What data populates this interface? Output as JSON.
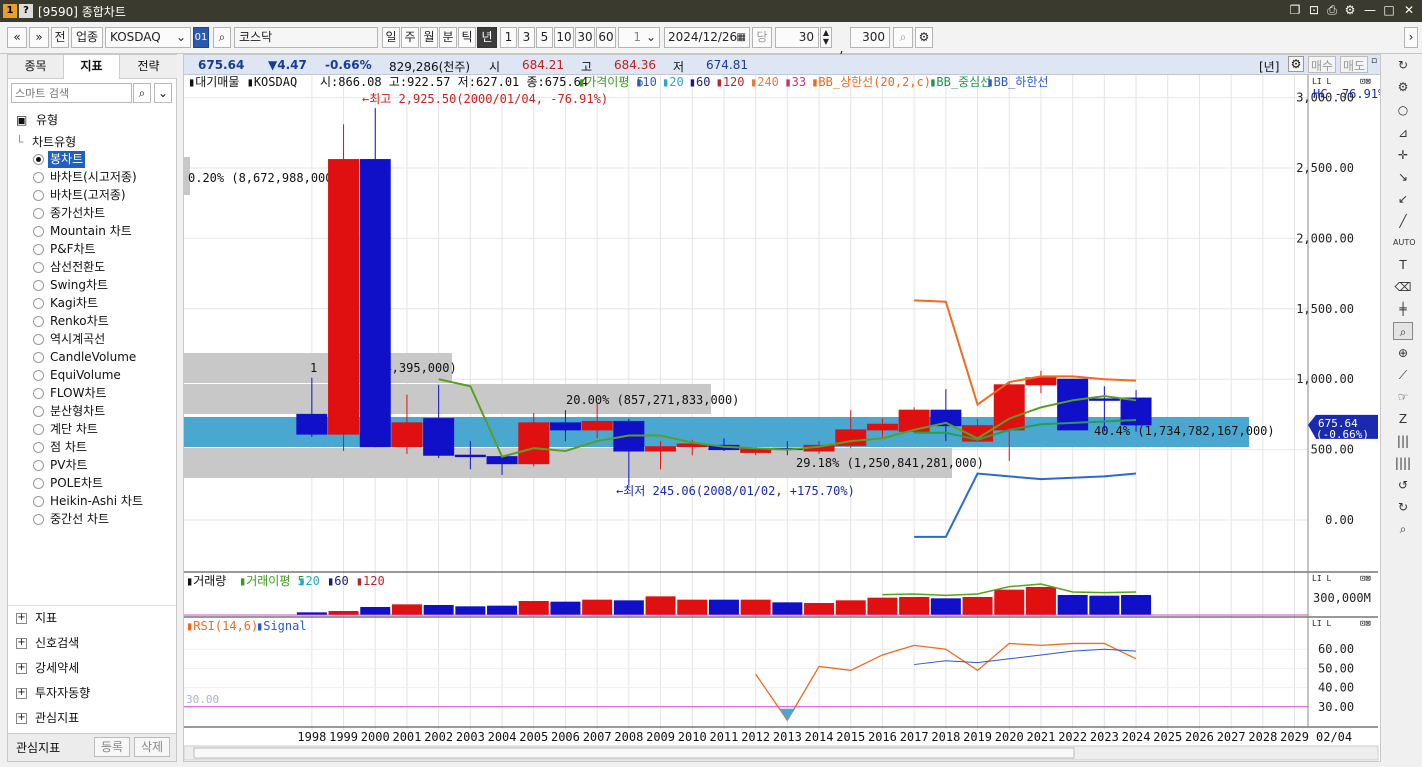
{
  "window": {
    "badge1": "1",
    "badge2": "?",
    "title": "[9590] 종합차트",
    "controls": [
      "❐",
      "⊡",
      "⎙",
      "⚙",
      "—",
      "□",
      "✕"
    ]
  },
  "toolbar": {
    "nav_prev": "«",
    "nav_down": "»",
    "btn_jeon": "전",
    "btn_upjong": "업종",
    "market_select": "KOSDAQ",
    "code_box": "01",
    "search_icon": "⌕",
    "name_field": "코스닥",
    "periods": [
      "일",
      "주",
      "월",
      "분",
      "틱",
      "년"
    ],
    "selected_period": "년",
    "intervals": [
      "1",
      "3",
      "5",
      "10",
      "30",
      "60"
    ],
    "count_select": "1",
    "date_value": "2024/12/26",
    "dang_label": "당",
    "view_count": "30",
    "slash": "/",
    "total_count": "300"
  },
  "left_panel": {
    "tabs": [
      "종목",
      "지표",
      "전략"
    ],
    "active_tab": "지표",
    "search_placeholder": "스마트 검색",
    "root_folder": "유형",
    "group_label": "차트유형",
    "chart_types": [
      "봉차트",
      "바차트(시고저종)",
      "바차트(고저종)",
      "종가선차트",
      "Mountain 차트",
      "P&F차트",
      "삼선전환도",
      "Swing차트",
      "Kagi차트",
      "Renko차트",
      "역시계곡선",
      "CandleVolume",
      "EquiVolume",
      "FLOW차트",
      "분산형차트",
      "계단 차트",
      "점 차트",
      "PV차트",
      "POLE차트",
      "Heikin-Ashi 차트",
      "중간선 차트"
    ],
    "selected_chart_type": "봉차트",
    "sections": [
      "지표",
      "신호검색",
      "강세약세",
      "투자자동향",
      "관심지표"
    ],
    "footer_label": "관심지표",
    "footer_register": "등록",
    "footer_delete": "삭제"
  },
  "quote_bar": {
    "price": "675.64",
    "change": "▼4.47",
    "change_pct": "-0.66%",
    "volume": "829,286(천주)",
    "open_label": "시",
    "open": "684.21",
    "high_label": "고",
    "high": "684.36",
    "low_label": "저",
    "low": "674.81",
    "period_badge": "[년]",
    "buy": "매수",
    "sell": "매도"
  },
  "price_pane": {
    "legend_prefix": "▮대기매물 ▮KOSDAQ",
    "legend_ohlc": "시:866.08 고:922.57 저:627.01 종:675.64",
    "legend_items": [
      {
        "text": "▮가격이평 5",
        "color": "#3a9a1a"
      },
      {
        "text": "▮10",
        "color": "#3355cc"
      },
      {
        "text": "▮20",
        "color": "#2aa8c8"
      },
      {
        "text": "▮60",
        "color": "#1a1a7a"
      },
      {
        "text": "▮120",
        "color": "#b02a2a"
      },
      {
        "text": "▮240",
        "color": "#e87a3a"
      },
      {
        "text": "▮33",
        "color": "#cc3366"
      },
      {
        "text": "▮BB_상한선(20,2,c)",
        "color": "#e86a1a"
      },
      {
        "text": "▮BB_중심선",
        "color": "#1a9a4a"
      },
      {
        "text": "▮BB_하한선",
        "color": "#2a5acc"
      }
    ],
    "hc_label": "HC -76.91%",
    "y_ticks": [
      "3,000.00",
      "2,500.00",
      "2,000.00",
      "1,500.00",
      "1,000.00",
      "500.00",
      "0.00"
    ],
    "annot_high": "←최고 2,925.50(2000/01/04, -76.91%)",
    "annot_low": "←최저 245.06(2008/01/02, +175.70%)",
    "vp_labels": [
      "0.20% (8,672,988,000)",
      "1",
      "394,395,000)",
      "20.00% (857,271,833,000)",
      "29.18% (1,250,841,281,000)",
      "40.4% (1,734,782,167,000)"
    ],
    "last_price_tag": "675.64",
    "last_pct_tag": "(-0.66%)"
  },
  "volume_pane": {
    "legend": "▮거래량",
    "legend_ma": [
      {
        "text": "▮거래이평 5",
        "color": "#3a9a1a"
      },
      {
        "text": "▮20",
        "color": "#2aa8c8"
      },
      {
        "text": "▮60",
        "color": "#1a1a7a"
      },
      {
        "text": "▮120",
        "color": "#b02a2a"
      }
    ],
    "y_tick": "300,000M"
  },
  "rsi_pane": {
    "legend_rsi": "▮RSI(14,6)",
    "legend_signal": "▮Signal",
    "level_label": "30.00",
    "y_ticks": [
      "60.00",
      "50.00",
      "40.00",
      "30.00"
    ]
  },
  "x_axis": {
    "years": [
      "1998",
      "1999",
      "2000",
      "2001",
      "2002",
      "2003",
      "2004",
      "2005",
      "2006",
      "2007",
      "2008",
      "2009",
      "2010",
      "2011",
      "2012",
      "2013",
      "2014",
      "2015",
      "2016",
      "2017",
      "2018",
      "2019",
      "2020",
      "2021",
      "2022",
      "2023",
      "2024",
      "2025",
      "2026",
      "2027",
      "2028",
      "2029"
    ],
    "date_badge": "02/04"
  },
  "chart_data": {
    "type": "candlestick",
    "x": [
      "1998",
      "1999",
      "2000",
      "2001",
      "2002",
      "2003",
      "2004",
      "2005",
      "2006",
      "2007",
      "2008",
      "2009",
      "2010",
      "2011",
      "2012",
      "2013",
      "2014",
      "2015",
      "2016",
      "2017",
      "2018",
      "2019",
      "2020",
      "2021",
      "2022",
      "2023",
      "2024"
    ],
    "open": [
      750,
      610,
      2560,
      520,
      720,
      460,
      450,
      400,
      690,
      640,
      700,
      490,
      520,
      530,
      480,
      510,
      490,
      530,
      640,
      630,
      780,
      560,
      640,
      960,
      1000,
      860,
      866.08
    ],
    "high": [
      1010,
      2810,
      2925.5,
      890,
      960,
      560,
      450,
      760,
      780,
      830,
      720,
      560,
      570,
      580,
      520,
      560,
      560,
      780,
      720,
      800,
      930,
      720,
      980,
      1060,
      1000,
      950,
      922.57
    ],
    "low": [
      590,
      490,
      520,
      470,
      440,
      360,
      320,
      380,
      560,
      580,
      245.06,
      360,
      460,
      490,
      460,
      460,
      470,
      510,
      590,
      620,
      560,
      560,
      420,
      900,
      640,
      630,
      627.01
    ],
    "close": [
      610,
      2560,
      520,
      690,
      460,
      450,
      400,
      690,
      640,
      700,
      490,
      520,
      540,
      500,
      510,
      500,
      530,
      640,
      680,
      780,
      670,
      670,
      960,
      1010,
      640,
      850,
      675.64
    ],
    "ma5": [
      null,
      null,
      null,
      null,
      1000,
      950,
      450,
      510,
      490,
      560,
      600,
      600,
      550,
      520,
      510,
      500,
      520,
      560,
      580,
      640,
      690,
      580,
      720,
      800,
      850,
      880,
      850
    ],
    "bb_upper": [
      null,
      null,
      null,
      null,
      null,
      null,
      null,
      null,
      null,
      null,
      null,
      null,
      null,
      null,
      null,
      null,
      null,
      null,
      null,
      1560,
      1550,
      820,
      980,
      1020,
      1020,
      1000,
      990
    ],
    "bb_middle": [
      null,
      null,
      null,
      null,
      null,
      null,
      null,
      null,
      null,
      null,
      null,
      null,
      null,
      null,
      null,
      null,
      null,
      null,
      null,
      620,
      620,
      570,
      640,
      680,
      690,
      700,
      710
    ],
    "bb_lower": [
      null,
      null,
      null,
      null,
      null,
      null,
      null,
      null,
      null,
      null,
      null,
      null,
      null,
      null,
      null,
      null,
      null,
      null,
      null,
      -120,
      -120,
      330,
      310,
      290,
      300,
      310,
      330
    ],
    "ylim": [
      0,
      3000
    ],
    "volume_scale_label": "300,000M",
    "volume": [
      40,
      60,
      120,
      160,
      150,
      130,
      140,
      210,
      200,
      230,
      220,
      280,
      230,
      230,
      230,
      190,
      180,
      220,
      260,
      270,
      250,
      270,
      380,
      420,
      300,
      290,
      300
    ],
    "rsi": [
      null,
      null,
      null,
      null,
      null,
      null,
      null,
      null,
      null,
      null,
      null,
      null,
      null,
      null,
      47,
      23,
      51,
      49,
      57,
      62,
      60,
      49,
      63,
      62,
      63,
      63,
      55
    ],
    "rsi_signal": [
      null,
      null,
      null,
      null,
      null,
      null,
      null,
      null,
      null,
      null,
      null,
      null,
      null,
      null,
      null,
      null,
      null,
      null,
      null,
      52,
      54,
      53,
      55,
      57,
      59,
      60,
      59
    ],
    "rsi_ylim": [
      20,
      70
    ]
  }
}
